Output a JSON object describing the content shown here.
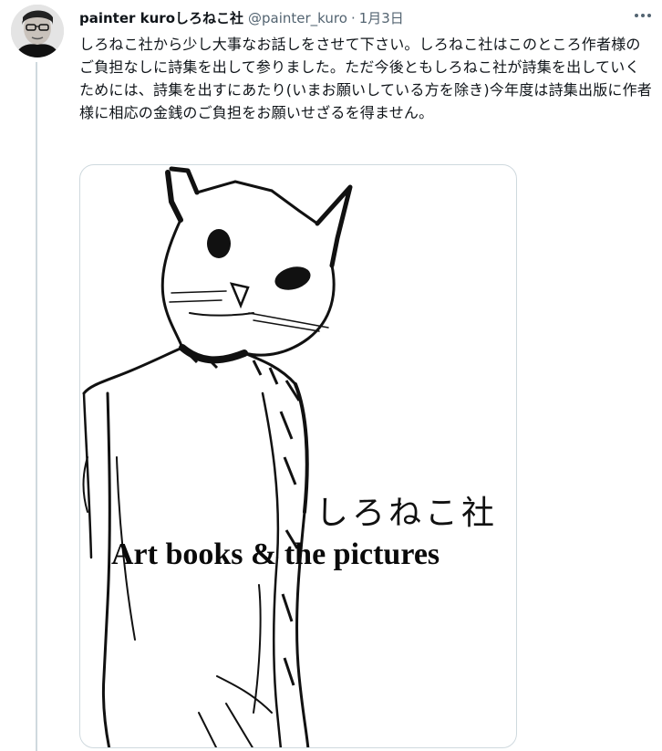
{
  "tweet": {
    "display_name": "painter kuroしろねこ社",
    "handle": "@painter_kuro",
    "separator": "·",
    "date": "1月3日",
    "text": "しろねこ社から少し大事なお話しをさせて下さい。しろねこ社はこのところ作者様のご負担なしに詩集を出して参りました。ただ今後ともしろねこ社が詩集を出していくためには、詩集を出すにあたり(いまお願いしている方を除き)今年度は詩集出版に作者様に相応の金銭のご負担をお願いせざるを得ません。"
  },
  "media": {
    "publisher_name": "しろねこ社",
    "tagline": "Art books & the pictures"
  },
  "icons": {
    "avatar": "user-avatar-photo",
    "more": "more-horizontal-icon"
  },
  "colors": {
    "text_primary": "#0f1419",
    "text_secondary": "#536471",
    "border": "#cfd9de"
  }
}
